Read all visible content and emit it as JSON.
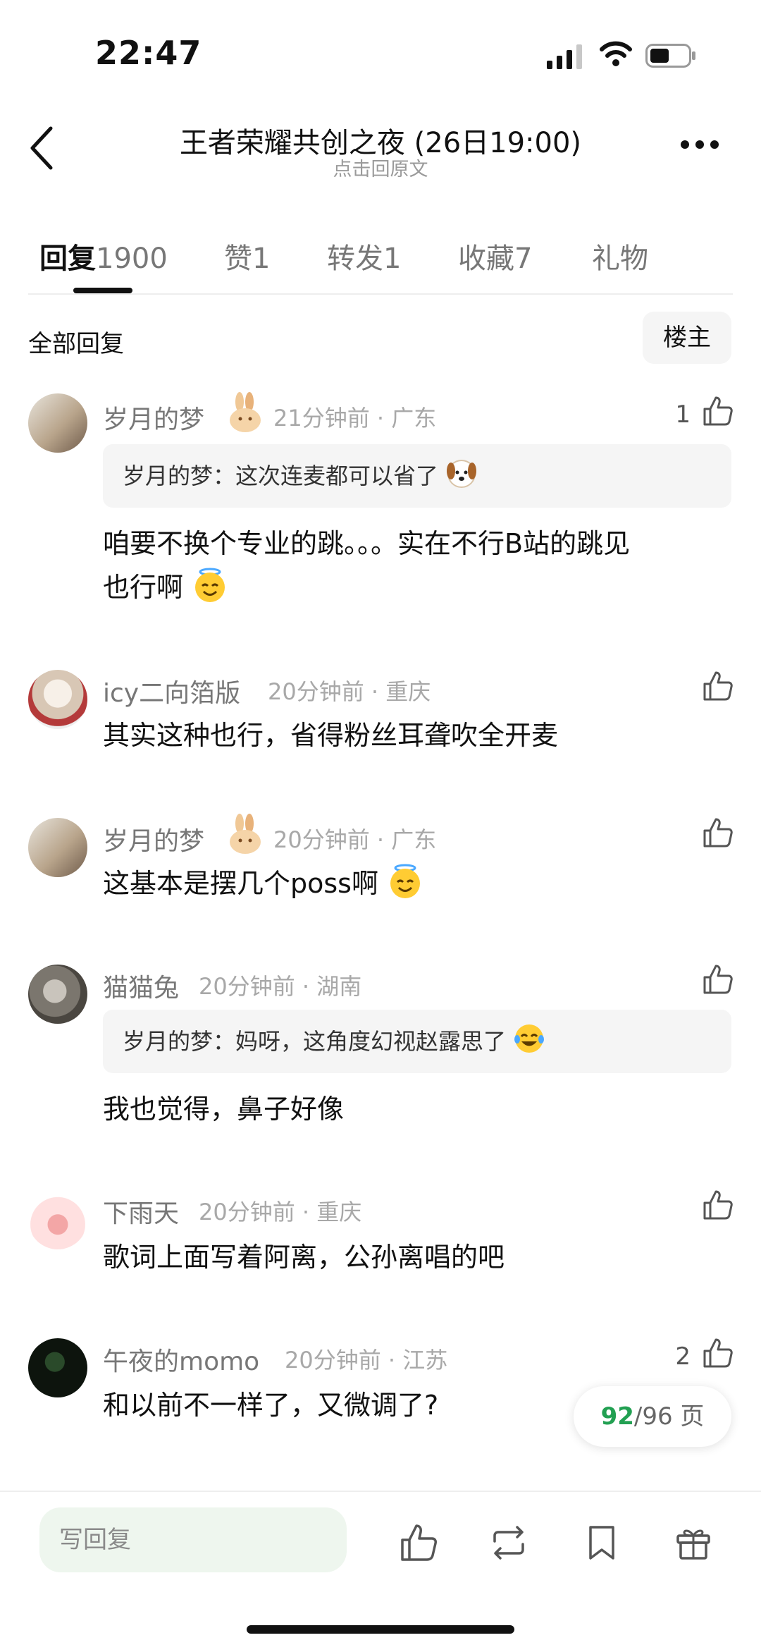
{
  "status_bar": {
    "time": "22:47"
  },
  "header": {
    "title": "王者荣耀共创之夜 (26日19:00)",
    "subtitle": "点击回原文"
  },
  "tabs": [
    {
      "label": "回复",
      "count": "1900",
      "active": true
    },
    {
      "label": "赞",
      "count": "1"
    },
    {
      "label": "转发",
      "count": "1"
    },
    {
      "label": "收藏",
      "count": "7"
    },
    {
      "label": "礼物",
      "count": ""
    }
  ],
  "filter": {
    "all_replies": "全部回复",
    "owner_only": "楼主"
  },
  "comments": [
    {
      "username": "岁月的梦",
      "time": "21分钟前",
      "location": "广东",
      "likes": "1",
      "quote": {
        "author": "岁月的梦：",
        "text": "这次连麦都可以省了"
      },
      "text": "咱要不换个专业的跳。。。实在不行B站的跳见",
      "text2": "也行啊"
    },
    {
      "username": "icy二向箔版",
      "time": "20分钟前",
      "location": "重庆",
      "likes": "",
      "text": "其实这种也行，省得粉丝耳聋吹全开麦"
    },
    {
      "username": "岁月的梦",
      "time": "20分钟前",
      "location": "广东",
      "likes": "",
      "text": "这基本是摆几个poss啊"
    },
    {
      "username": "猫猫兔",
      "time": "20分钟前",
      "location": "湖南",
      "likes": "",
      "quote": {
        "author": "岁月的梦：",
        "text": "妈呀，这角度幻视赵露思了"
      },
      "text": "我也觉得，鼻子好像"
    },
    {
      "username": "下雨天",
      "time": "20分钟前",
      "location": "重庆",
      "likes": "",
      "text": "歌词上面写着阿离，公孙离唱的吧"
    },
    {
      "username": "午夜的momo",
      "time": "20分钟前",
      "location": "江苏",
      "likes": "2",
      "text": "和以前不一样了，又微调了?"
    }
  ],
  "pager": {
    "current": "92",
    "total": "/96 页"
  },
  "bottom_bar": {
    "placeholder": "写回复"
  },
  "colors": {
    "accent_green": "#22a052",
    "input_bg": "#eef6ee"
  },
  "icons": [
    "back-icon",
    "more-icon",
    "thumbs-up-icon",
    "repost-icon",
    "bookmark-icon",
    "gift-icon"
  ]
}
